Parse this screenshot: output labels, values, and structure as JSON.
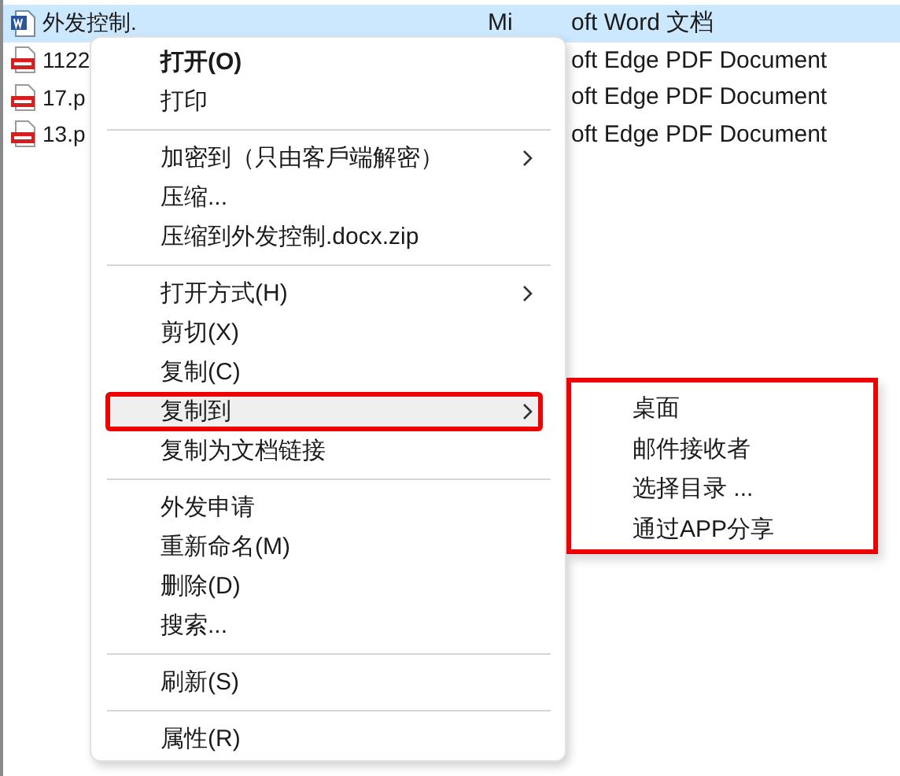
{
  "files": [
    {
      "kind": "word",
      "name": "外发控制.",
      "type_prefix": "Mi",
      "type": "oft Word 文档",
      "selected": true
    },
    {
      "kind": "pdf",
      "name": "1122",
      "type": "oft Edge PDF Document",
      "selected": false
    },
    {
      "kind": "pdf",
      "name": "17.p",
      "type": "oft Edge PDF Document",
      "selected": false
    },
    {
      "kind": "pdf",
      "name": "13.p",
      "type": "oft Edge PDF Document",
      "selected": false
    }
  ],
  "context_menu": {
    "items": [
      {
        "kind": "item",
        "label": "打开(O)",
        "default": true,
        "has_submenu": false,
        "selected": false,
        "outlined": false
      },
      {
        "kind": "item",
        "label": "打印",
        "default": false,
        "has_submenu": false,
        "selected": false,
        "outlined": false
      },
      {
        "kind": "separator"
      },
      {
        "kind": "item",
        "label": "加密到（只由客戶端解密）",
        "default": false,
        "has_submenu": true,
        "selected": false,
        "outlined": false
      },
      {
        "kind": "item",
        "label": "压缩...",
        "default": false,
        "has_submenu": false,
        "selected": false,
        "outlined": false
      },
      {
        "kind": "item",
        "label": "压缩到外发控制.docx.zip",
        "default": false,
        "has_submenu": false,
        "selected": false,
        "outlined": false
      },
      {
        "kind": "separator"
      },
      {
        "kind": "item",
        "label": "打开方式(H)",
        "default": false,
        "has_submenu": true,
        "selected": false,
        "outlined": false
      },
      {
        "kind": "item",
        "label": "剪切(X)",
        "default": false,
        "has_submenu": false,
        "selected": false,
        "outlined": false
      },
      {
        "kind": "item",
        "label": "复制(C)",
        "default": false,
        "has_submenu": false,
        "selected": false,
        "outlined": false
      },
      {
        "kind": "item",
        "label": "复制到",
        "default": false,
        "has_submenu": true,
        "selected": true,
        "outlined": true
      },
      {
        "kind": "item",
        "label": "复制为文档链接",
        "default": false,
        "has_submenu": false,
        "selected": false,
        "outlined": false
      },
      {
        "kind": "separator"
      },
      {
        "kind": "item",
        "label": "外发申请",
        "default": false,
        "has_submenu": false,
        "selected": false,
        "outlined": false
      },
      {
        "kind": "item",
        "label": "重新命名(M)",
        "default": false,
        "has_submenu": false,
        "selected": false,
        "outlined": false
      },
      {
        "kind": "item",
        "label": "删除(D)",
        "default": false,
        "has_submenu": false,
        "selected": false,
        "outlined": false
      },
      {
        "kind": "item",
        "label": "搜索...",
        "default": false,
        "has_submenu": false,
        "selected": false,
        "outlined": false
      },
      {
        "kind": "separator"
      },
      {
        "kind": "item",
        "label": "刷新(S)",
        "default": false,
        "has_submenu": false,
        "selected": false,
        "outlined": false
      },
      {
        "kind": "separator"
      },
      {
        "kind": "item",
        "label": "属性(R)",
        "default": false,
        "has_submenu": false,
        "selected": false,
        "outlined": false
      }
    ]
  },
  "submenu": {
    "outlined": true,
    "items": [
      "桌面",
      "邮件接收者",
      "选择目录 ...",
      "通过APP分享"
    ]
  }
}
